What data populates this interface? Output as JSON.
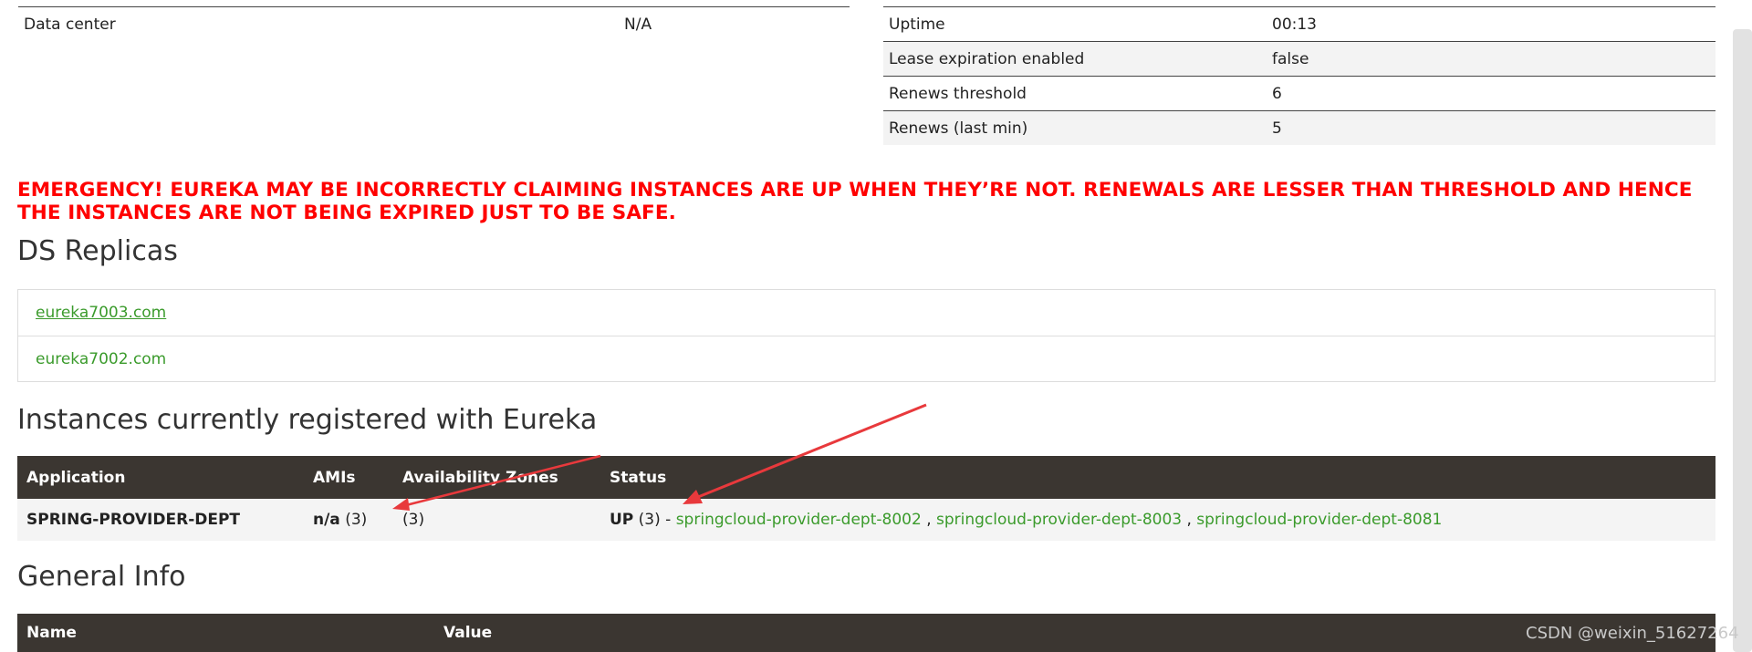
{
  "top_left": [
    {
      "key": "Data center",
      "value": "N/A"
    }
  ],
  "top_right": [
    {
      "key": "Uptime",
      "value": "00:13"
    },
    {
      "key": "Lease expiration enabled",
      "value": "false"
    },
    {
      "key": "Renews threshold",
      "value": "6"
    },
    {
      "key": "Renews (last min)",
      "value": "5"
    }
  ],
  "emergency": "EMERGENCY! EUREKA MAY BE INCORRECTLY CLAIMING INSTANCES ARE UP WHEN THEY’RE NOT. RENEWALS ARE LESSER THAN THRESHOLD AND HENCE THE INSTANCES ARE NOT BEING EXPIRED JUST TO BE SAFE.",
  "replicas": {
    "title": "DS Replicas",
    "items": [
      "eureka7003.com",
      "eureka7002.com"
    ]
  },
  "instances": {
    "title": "Instances currently registered with Eureka",
    "headers": {
      "application": "Application",
      "amis": "AMIs",
      "zones": "Availability Zones",
      "status": "Status"
    },
    "rows": [
      {
        "application": "SPRING-PROVIDER-DEPT",
        "ami_bold": "n/a",
        "ami_count": "(3)",
        "zones": "(3)",
        "status_bold": "UP",
        "status_count": "(3) -",
        "links": [
          "springcloud-provider-dept-8002",
          "springcloud-provider-dept-8003",
          "springcloud-provider-dept-8081"
        ],
        "separator": ","
      }
    ]
  },
  "general_info": {
    "title": "General Info",
    "headers": {
      "name": "Name",
      "value": "Value"
    }
  },
  "watermark": "CSDN @weixin_51627264",
  "colors": {
    "emergency": "#ff0000",
    "link": "#3b9b2c",
    "header_bg": "#3b3631",
    "arrow": "#e8393c"
  }
}
